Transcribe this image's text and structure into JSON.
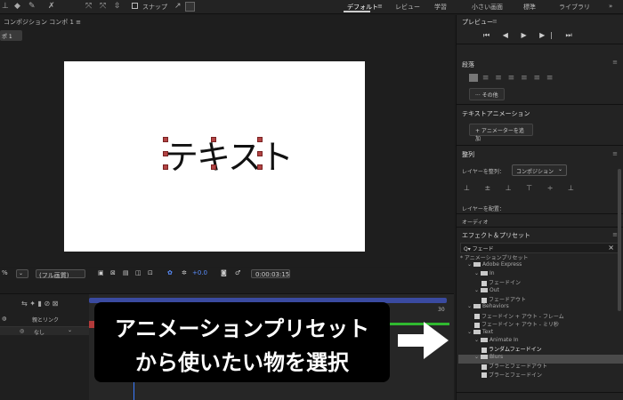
{
  "toolbar": {
    "snap_label": "スナップ",
    "workspaces": [
      "デフォルト",
      "≡",
      "レビュー",
      "学習",
      "小さい画面",
      "標準",
      "ライブラリ",
      "»"
    ]
  },
  "comp_panel": {
    "header": "コンポジション コンポ 1  ≡",
    "tab": "ポ 1",
    "canvas_text": "テキスト"
  },
  "viewer_bar": {
    "zoom_suffix": "%",
    "quality": "(フル画質)",
    "exposure": "+0.0",
    "timecode": "0:00:03:15"
  },
  "timeline": {
    "col_parent": "親とリンク",
    "parent_value": "なし",
    "end_marker": "30"
  },
  "overlay": {
    "line1": "アニメーションプリセット",
    "line2": "から使いたい物を選択"
  },
  "right_panel": {
    "preview_title": "プレビュー",
    "preview_menu": "≡",
    "paragraph_title": "段落",
    "more_label": "··· その他",
    "text_anim_title": "テキストアニメーション",
    "add_animator": "+ アニメーターを追加",
    "align_title": "整列",
    "align_to_label": "レイヤーを整列：",
    "align_to_value": "コンポジション",
    "distribute_label": "レイヤーを配置：",
    "audio_label": "オーディオ",
    "effects_title": "エフェクト＆プリセット",
    "search_value": "フェード",
    "tree": [
      {
        "label": "* アニメーションプリセット",
        "indent": 0,
        "kind": "root"
      },
      {
        "label": "Adobe Express",
        "indent": 1,
        "kind": "folder"
      },
      {
        "label": "In",
        "indent": 2,
        "kind": "folder"
      },
      {
        "label": "フェードイン",
        "indent": 3,
        "kind": "preset"
      },
      {
        "label": "Out",
        "indent": 2,
        "kind": "folder"
      },
      {
        "label": "フェードアウト",
        "indent": 3,
        "kind": "preset"
      },
      {
        "label": "Behaviors",
        "indent": 1,
        "kind": "folder"
      },
      {
        "label": "フェードイン + アウト - フレーム",
        "indent": 2,
        "kind": "preset"
      },
      {
        "label": "フェードイン + アウト - ミリ秒",
        "indent": 2,
        "kind": "preset"
      },
      {
        "label": "Text",
        "indent": 1,
        "kind": "folder"
      },
      {
        "label": "Animate In",
        "indent": 2,
        "kind": "folder"
      },
      {
        "label": "ランダムフェードイン",
        "indent": 3,
        "kind": "preset",
        "selected": true
      },
      {
        "label": "Blurs",
        "indent": 2,
        "kind": "folder"
      },
      {
        "label": "ブラーとフェードアウト",
        "indent": 3,
        "kind": "preset"
      },
      {
        "label": "ブラーとフェードイン",
        "indent": 3,
        "kind": "preset"
      }
    ]
  }
}
